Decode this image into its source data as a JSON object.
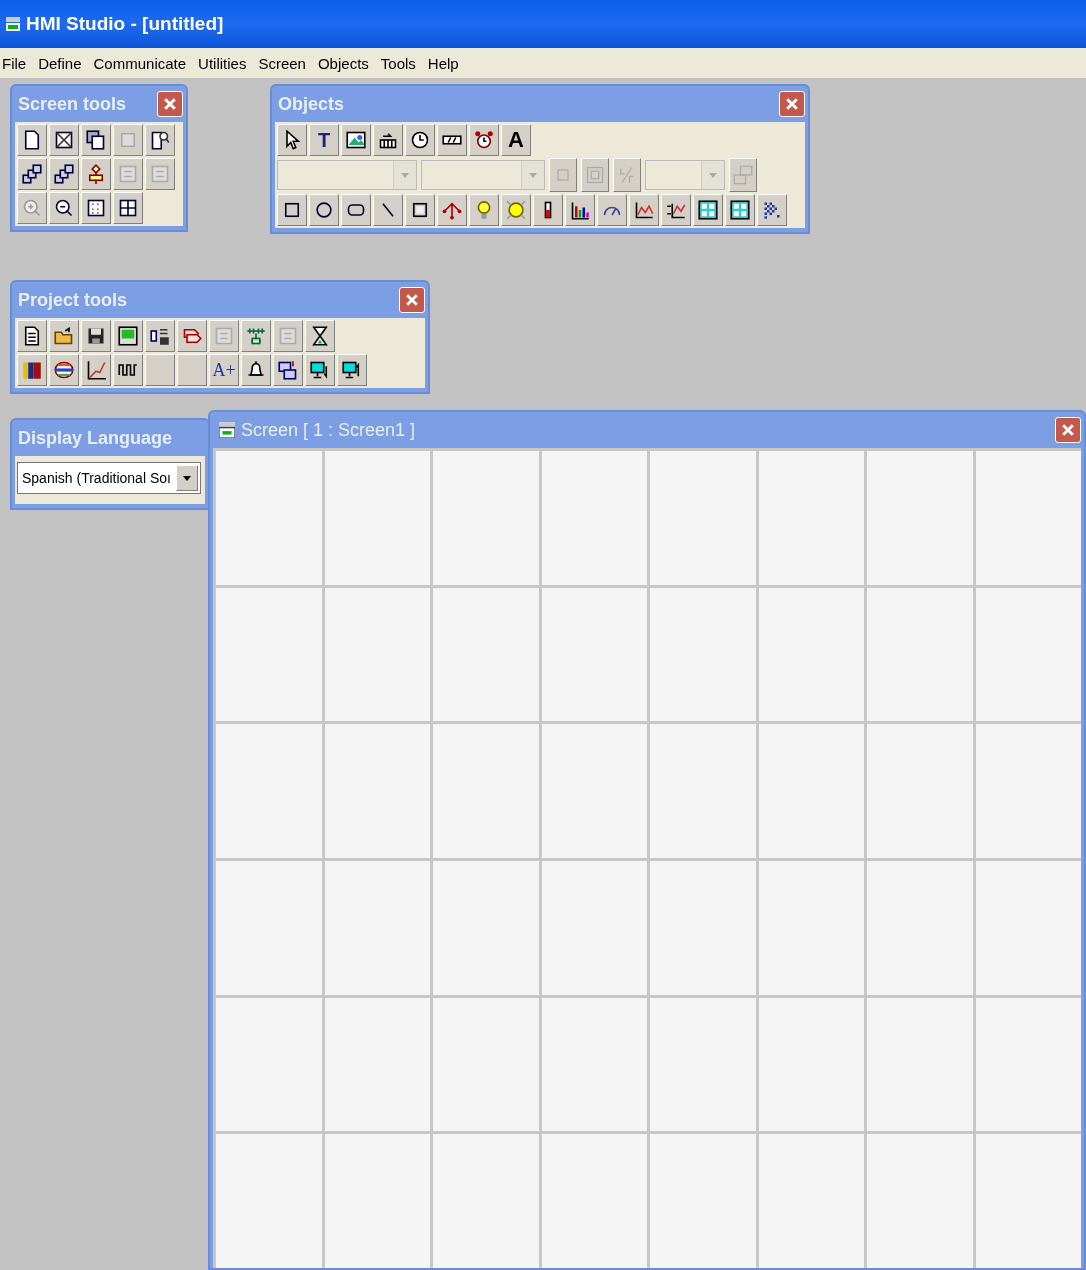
{
  "window": {
    "title": "HMI Studio - [untitled]"
  },
  "menu": [
    {
      "label": "File"
    },
    {
      "label": "Define"
    },
    {
      "label": "Communicate"
    },
    {
      "label": "Utilities"
    },
    {
      "label": "Screen"
    },
    {
      "label": "Objects"
    },
    {
      "label": "Tools"
    },
    {
      "label": "Help"
    }
  ],
  "screen_tools": {
    "title": "Screen tools"
  },
  "objects": {
    "title": "Objects",
    "text_tool": "T",
    "font_tool": "A"
  },
  "project_tools": {
    "title": "Project tools",
    "font_size_tool": "A+"
  },
  "display_language": {
    "title": "Display Language",
    "value": "Spanish (Traditional Soı"
  },
  "screen_window": {
    "title": "Screen [ 1 : Screen1 ]"
  }
}
